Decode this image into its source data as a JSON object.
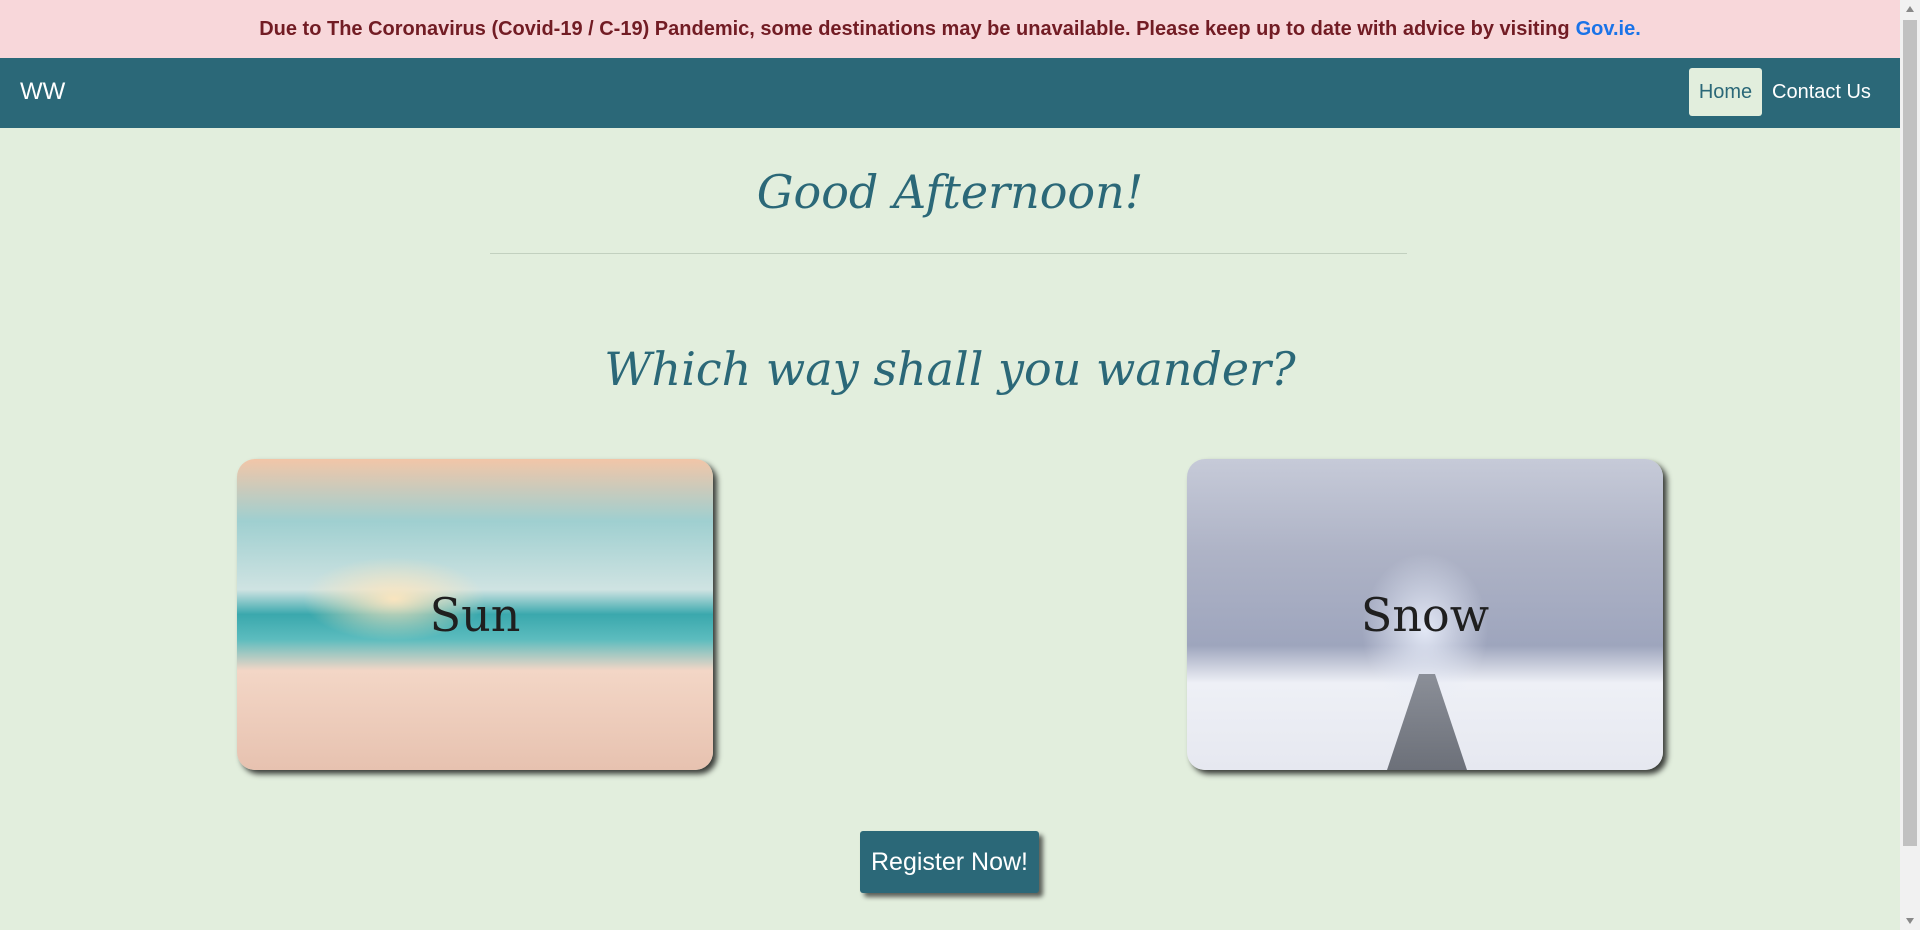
{
  "alert": {
    "text": "Due to The Coronavirus (Covid-19 / C-19) Pandemic, some destinations may be unavailable. Please keep up to date with advice by visiting",
    "link_text": "Gov.ie."
  },
  "navbar": {
    "brand": "WW",
    "items": [
      {
        "label": "Home",
        "active": true
      },
      {
        "label": "Contact Us",
        "active": false
      }
    ]
  },
  "main": {
    "greeting": "Good Afternoon!",
    "question": "Which way shall you wander?",
    "cards": [
      {
        "label": "Sun"
      },
      {
        "label": "Snow"
      }
    ],
    "register_label": "Register Now!"
  },
  "colors": {
    "primary": "#2b6878",
    "background": "#e2eedd",
    "alert_bg": "#f8d7da",
    "alert_text": "#721c24",
    "link": "#1a73e8"
  }
}
